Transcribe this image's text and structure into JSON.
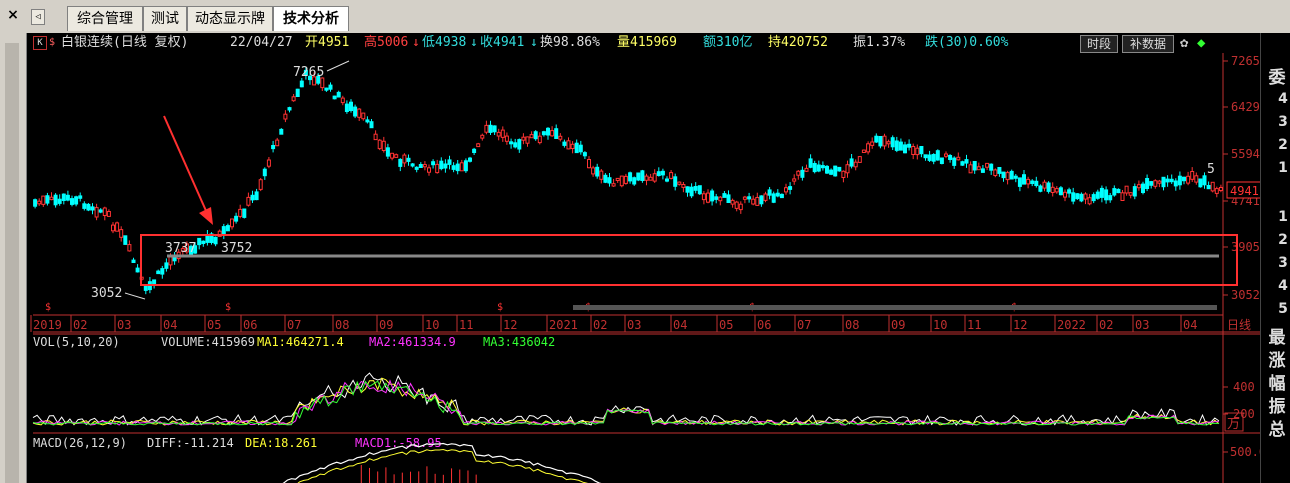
{
  "tabs": {
    "close": "×",
    "items": [
      {
        "label": "综合管理",
        "active": false
      },
      {
        "label": "测试",
        "active": false
      },
      {
        "label": "动态显示牌",
        "active": false
      },
      {
        "label": "技术分析",
        "active": true
      }
    ]
  },
  "header": {
    "k_label": "K",
    "stock": "白银连续(日线 复权)",
    "date": "22/04/27",
    "open": "开4951",
    "high": "高5006",
    "low": "低4938",
    "close": "收4941",
    "turnover": "换98.86%",
    "volume": "量415969",
    "amount": "额310亿",
    "hold": "持420752",
    "amplitude": "振1.37%",
    "fall": "跌(30)0.60%",
    "btn_period": "时段",
    "btn_supplement": "补数据"
  },
  "colors": {
    "up": "#ff3333",
    "down": "#00ffff",
    "axis": "#c03030",
    "ma1": "#ffff33",
    "ma2": "#ff33ff",
    "ma3": "#33ff33",
    "white": "#ffffff"
  },
  "price_axis": {
    "ticks": [
      "7265",
      "6429",
      "5594",
      "4741",
      "3905",
      "3052"
    ],
    "current": "4941"
  },
  "annotations": {
    "high_label": "7265",
    "low_label": "3052",
    "mid_label_1": "3737",
    "mid_label_2": "3752",
    "right_label": "5"
  },
  "date_axis": {
    "labels": [
      "2019",
      "02",
      "03",
      "04",
      "05",
      "06",
      "07",
      "08",
      "09",
      "10",
      "11",
      "12",
      "2021",
      "02",
      "03",
      "04",
      "05",
      "06",
      "07",
      "08",
      "09",
      "10",
      "11",
      "12",
      "2022",
      "02",
      "03",
      "04"
    ],
    "period": "日线"
  },
  "volume": {
    "title": "VOL(5,10,20)",
    "value": "VOLUME:415969",
    "ma1": "MA1:464271.4",
    "ma2": "MA2:461334.9",
    "ma3": "MA3:436042",
    "ticks": [
      "400",
      "200"
    ],
    "unit": "万"
  },
  "macd": {
    "title": "MACD(26,12,9)",
    "diff": "DIFF:-11.214",
    "dea": "DEA:18.261",
    "macd": "MACD1:-58.95",
    "tick": "500.0"
  },
  "right_panel": [
    "委",
    "最",
    "涨",
    "幅",
    "振",
    "总"
  ],
  "right_digits": [
    "4",
    "3",
    "2",
    "1",
    "1",
    "2",
    "3",
    "4",
    "5"
  ]
}
